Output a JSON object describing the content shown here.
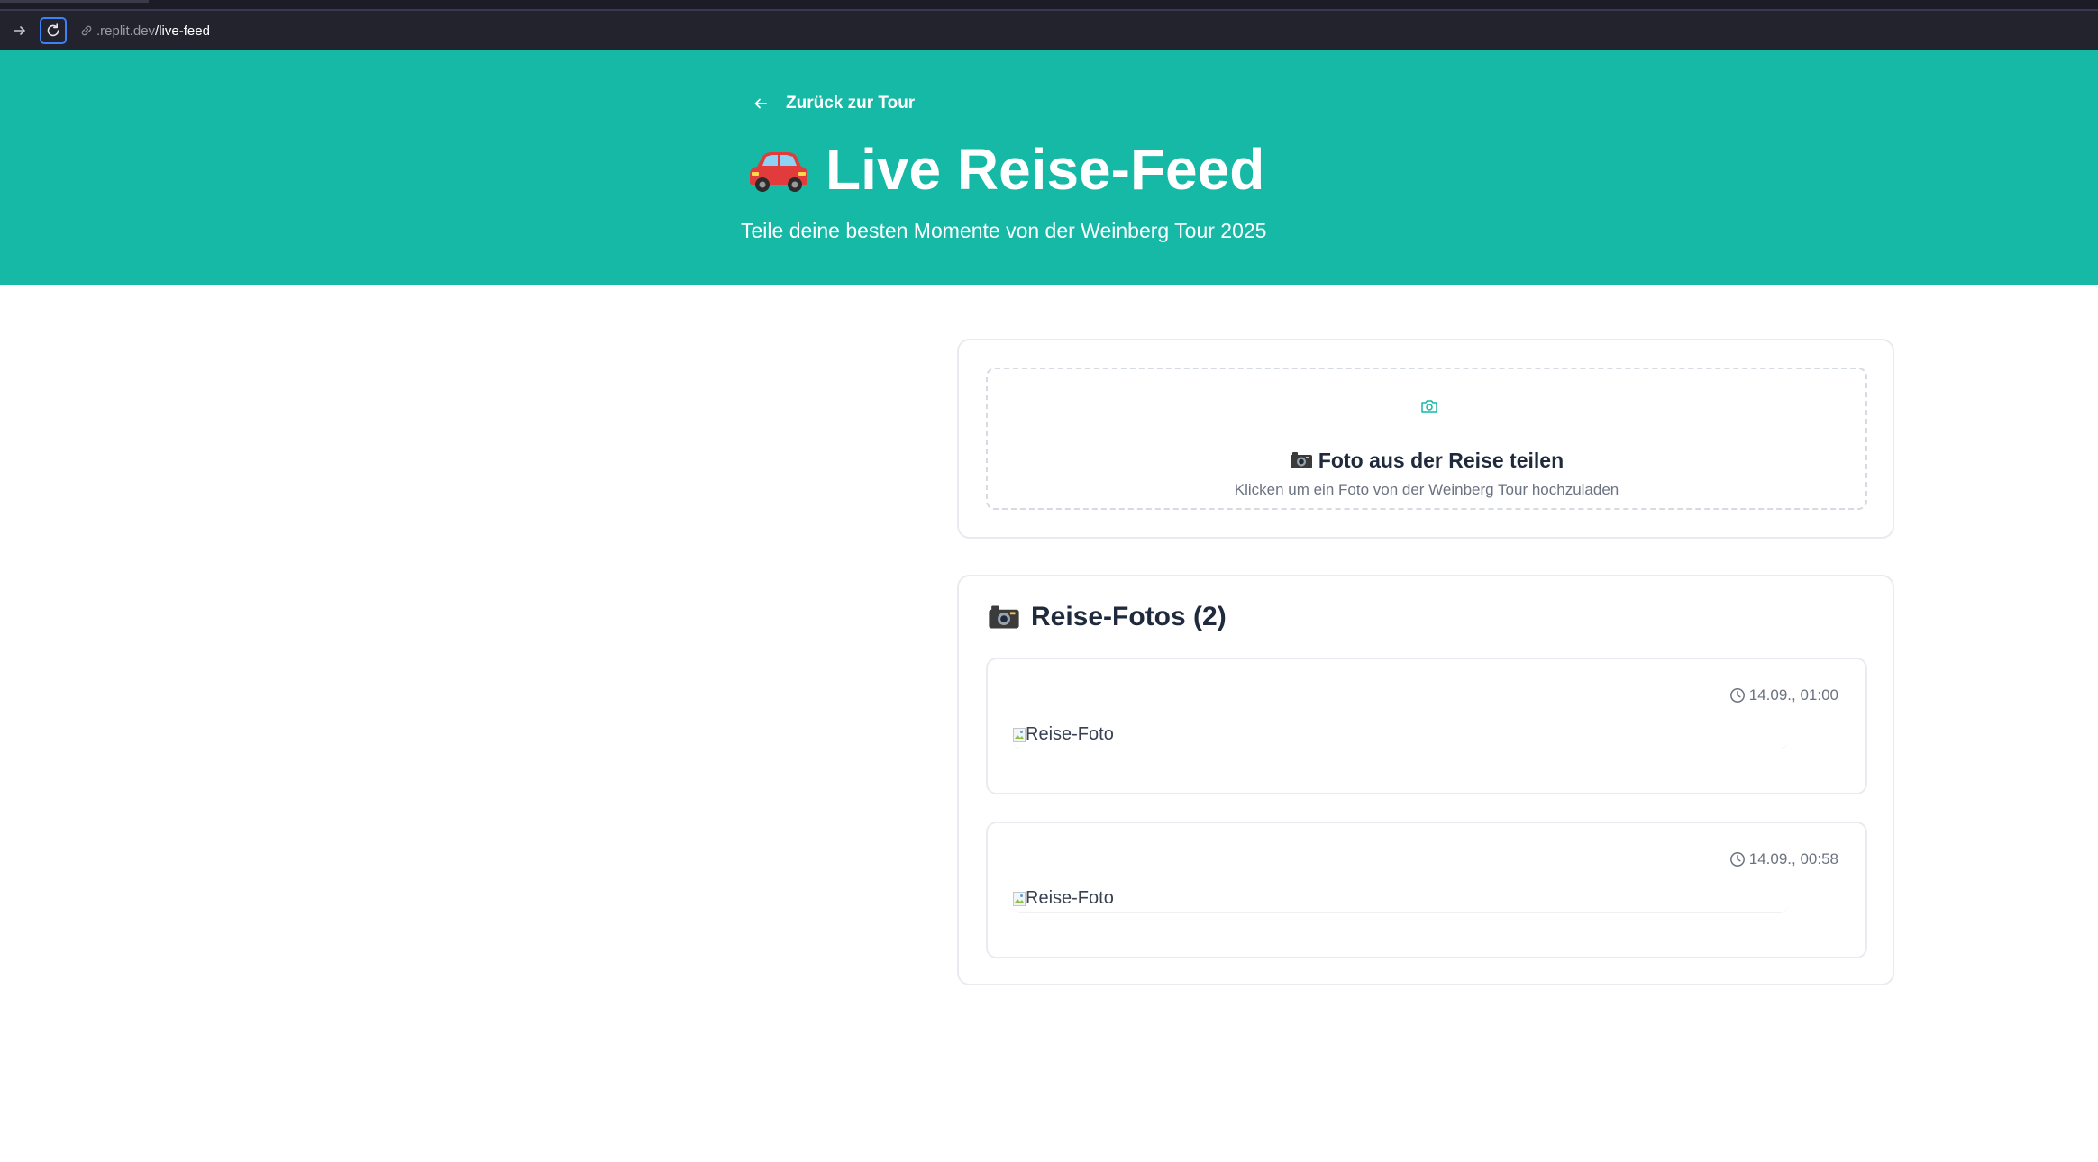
{
  "browser": {
    "url_domain": ".replit.dev",
    "url_path": "/live-feed"
  },
  "hero": {
    "back_label": "Zurück zur Tour",
    "title": "Live Reise-Feed",
    "subtitle": "Teile deine besten Momente von der Weinberg Tour 2025",
    "background_color": "#16b8a6"
  },
  "upload": {
    "title": "Foto aus der Reise teilen",
    "hint": "Klicken um ein Foto von der Weinberg Tour hochzuladen"
  },
  "feed": {
    "title": "Reise-Fotos (2)",
    "posts": [
      {
        "time": "14.09., 01:00",
        "image_alt": "Reise-Foto"
      },
      {
        "time": "14.09., 00:58",
        "image_alt": "Reise-Foto"
      }
    ]
  }
}
